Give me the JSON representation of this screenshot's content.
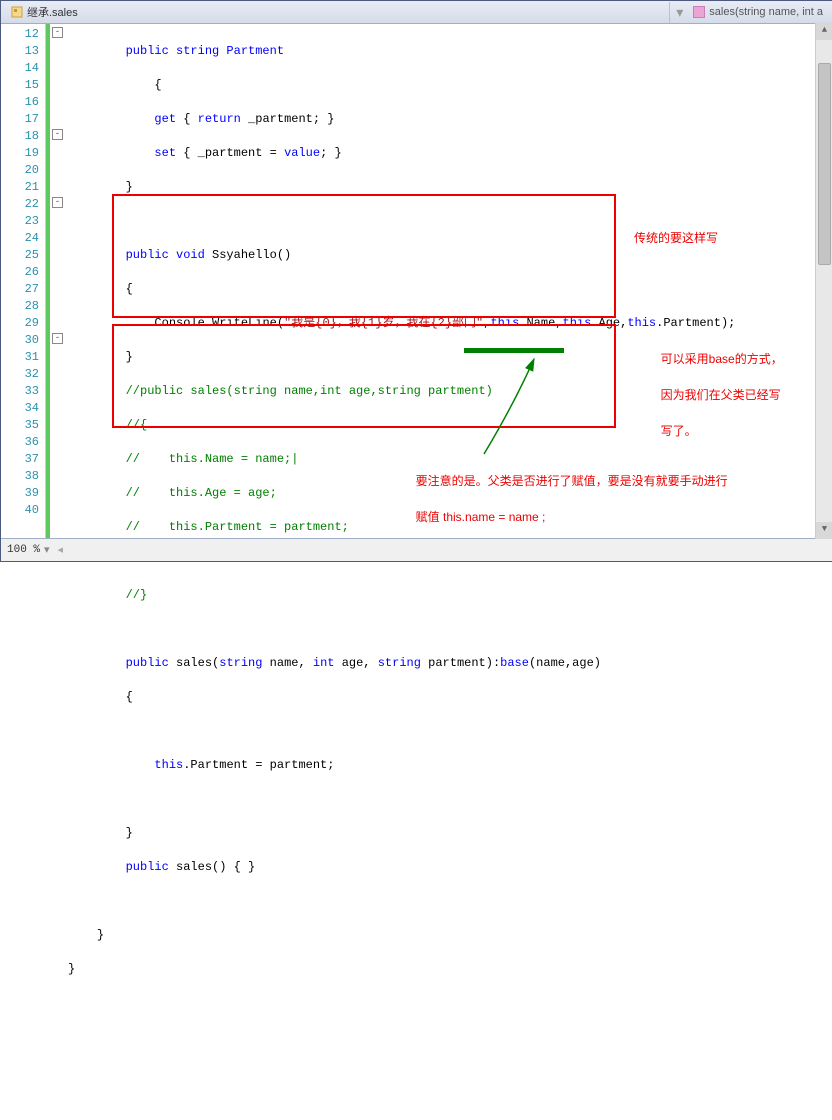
{
  "tab": {
    "title": "继承.sales"
  },
  "member_dropdown": {
    "text": "sales(string name, int a"
  },
  "lines": {
    "start": 12,
    "end": 40
  },
  "code": {
    "l12": "public string Partment",
    "l13": "{",
    "l14_a": "get",
    "l14_b": " { ",
    "l14_c": "return",
    "l14_d": " _partment; }",
    "l15_a": "set",
    "l15_b": " { _partment = ",
    "l15_c": "value",
    "l15_d": "; }",
    "l16": "}",
    "l18_a": "public void",
    "l18_b": " Ssyahello()",
    "l19": "{",
    "l20_a": "Console.WriteLine(",
    "l20_b": "\"我是{0}，我{1}岁，我在{2}部门\"",
    "l20_c": ",",
    "l20_d": "this",
    "l20_e": ".Name,",
    "l20_f": "this",
    "l20_g": ".Age,",
    "l20_h": "this",
    "l20_i": ".Partment);",
    "l21": "}",
    "l22": "//public sales(string name,int age,string partment)",
    "l23": "//{",
    "l24": "//    this.Name = name;|",
    "l25": "//    this.Age = age;",
    "l26": "//    this.Partment = partment;",
    "l28": "//}",
    "l30_a": "public",
    "l30_b": " sales(",
    "l30_c": "string",
    "l30_d": " name, ",
    "l30_e": "int",
    "l30_f": " age, ",
    "l30_g": "string",
    "l30_h": " partment):",
    "l30_i": "base",
    "l30_j": "(name,age)",
    "l31": "{",
    "l33_a": "this",
    "l33_b": ".Partment = partment;",
    "l35": "}",
    "l36_a": "public",
    "l36_b": " sales() { }",
    "l38": "}",
    "l39": "}"
  },
  "annotations": {
    "note1": "传统的要这样写",
    "note2_line1": "可以采用base的方式，",
    "note2_line2": "因为我们在父类已经写",
    "note2_line3": "写了。",
    "note3_line1": "要注意的是。父类是否进行了赋值，要是没有就要手动进行",
    "note3_line2": "赋值 this.name = name ;"
  },
  "footer": {
    "zoom": "100 %"
  }
}
